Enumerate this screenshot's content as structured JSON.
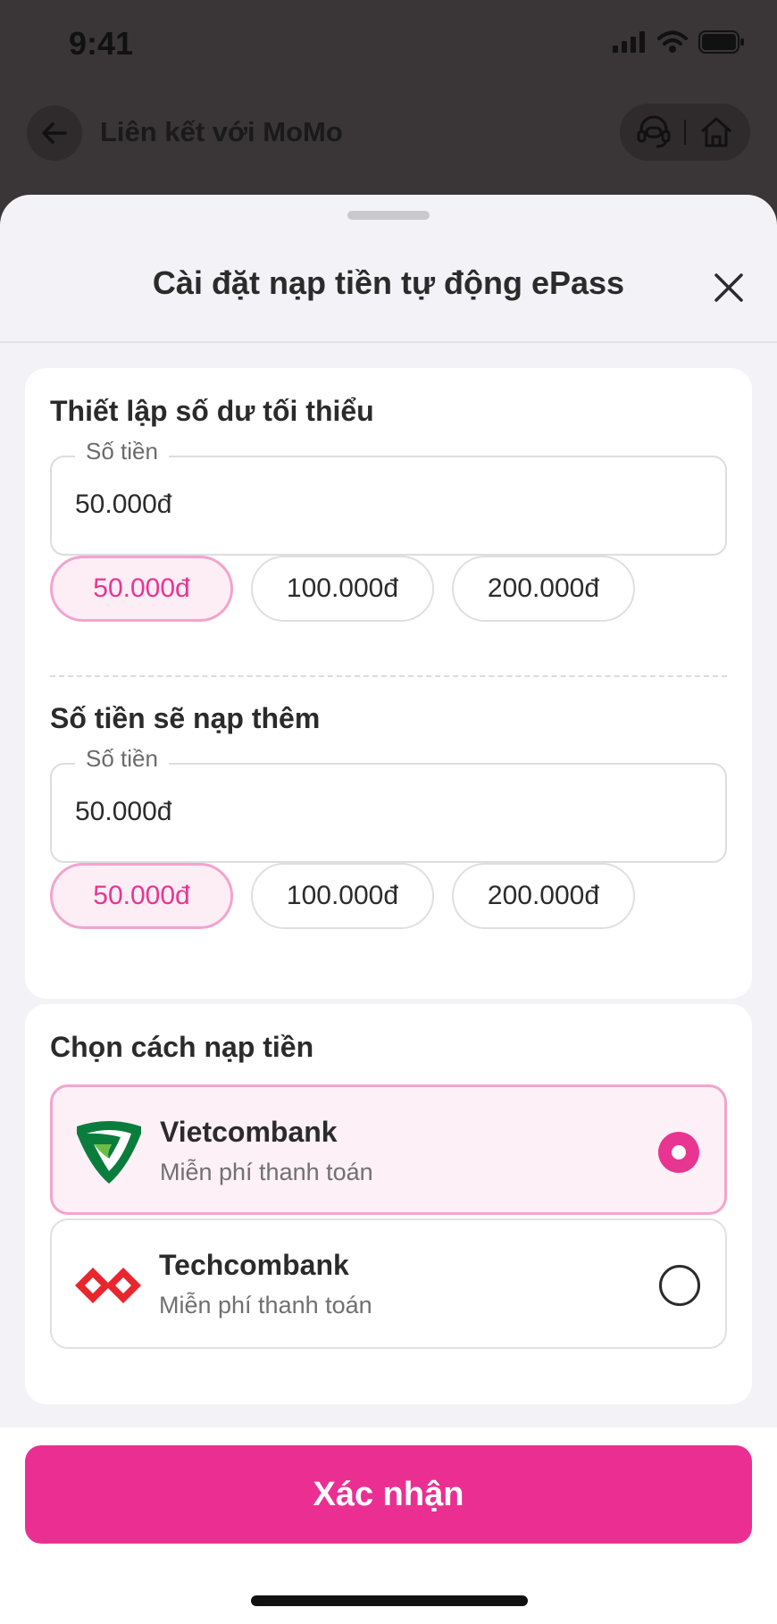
{
  "status_bar": {
    "time": "9:41"
  },
  "app_bar": {
    "title": "Liên kết với MoMo"
  },
  "sheet": {
    "title": "Cài đặt nạp tiền tự động ePass",
    "min_balance": {
      "title": "Thiết lập số dư tối thiểu",
      "field_label": "Số tiền",
      "field_value": "50.000đ",
      "chips": [
        "50.000đ",
        "100.000đ",
        "200.000đ"
      ],
      "selected_chip": 0
    },
    "topup_amount": {
      "title": "Số tiền sẽ nạp thêm",
      "field_label": "Số tiền",
      "field_value": "50.000đ",
      "chips": [
        "50.000đ",
        "100.000đ",
        "200.000đ"
      ],
      "selected_chip": 0
    },
    "payment": {
      "title": "Chọn cách nạp tiền",
      "banks": [
        {
          "name": "Vietcombank",
          "subtitle": "Miễn phí thanh toán",
          "selected": true,
          "icon": "vietcombank-logo"
        },
        {
          "name": "Techcombank",
          "subtitle": "Miễn phí thanh toán",
          "selected": false,
          "icon": "techcombank-logo"
        }
      ]
    },
    "confirm_label": "Xác nhận"
  },
  "colors": {
    "accent": "#eb2f92",
    "accent_light": "#fdeef6",
    "accent_border": "#f3a4cc",
    "overlay": "#3a3536"
  }
}
